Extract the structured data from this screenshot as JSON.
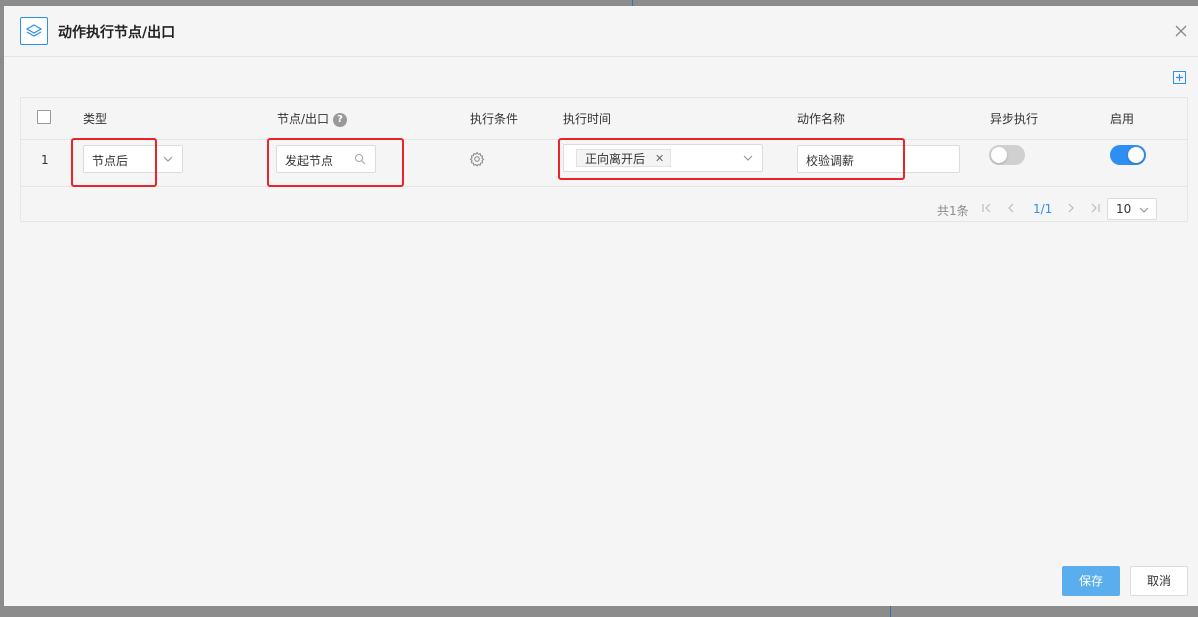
{
  "dialog": {
    "title": "动作执行节点/出口",
    "add_icon": "plus-square-icon",
    "close_icon": "close-icon"
  },
  "table": {
    "headers": {
      "type": "类型",
      "node_exit": "节点/出口",
      "condition": "执行条件",
      "exec_time": "执行时间",
      "action_name": "动作名称",
      "async": "异步执行",
      "enabled": "启用"
    },
    "help_glyph": "?",
    "rows": [
      {
        "index": "1",
        "type": "节点后",
        "node": "发起节点",
        "condition_icon": "gear-icon",
        "exec_time_tag": "正向离开后",
        "action_name": "校验调薪",
        "async": false,
        "enabled": true
      }
    ]
  },
  "pagination": {
    "total": "共1条",
    "current": "1/1",
    "page_size": "10"
  },
  "footer": {
    "save": "保存",
    "cancel": "取消"
  },
  "colors": {
    "accent": "#2f8ef2",
    "toggle_on": "#2f8ef2",
    "toggle_off": "#d0d0d0",
    "save_button": "#5aaeee",
    "highlight": "#e8232a"
  }
}
